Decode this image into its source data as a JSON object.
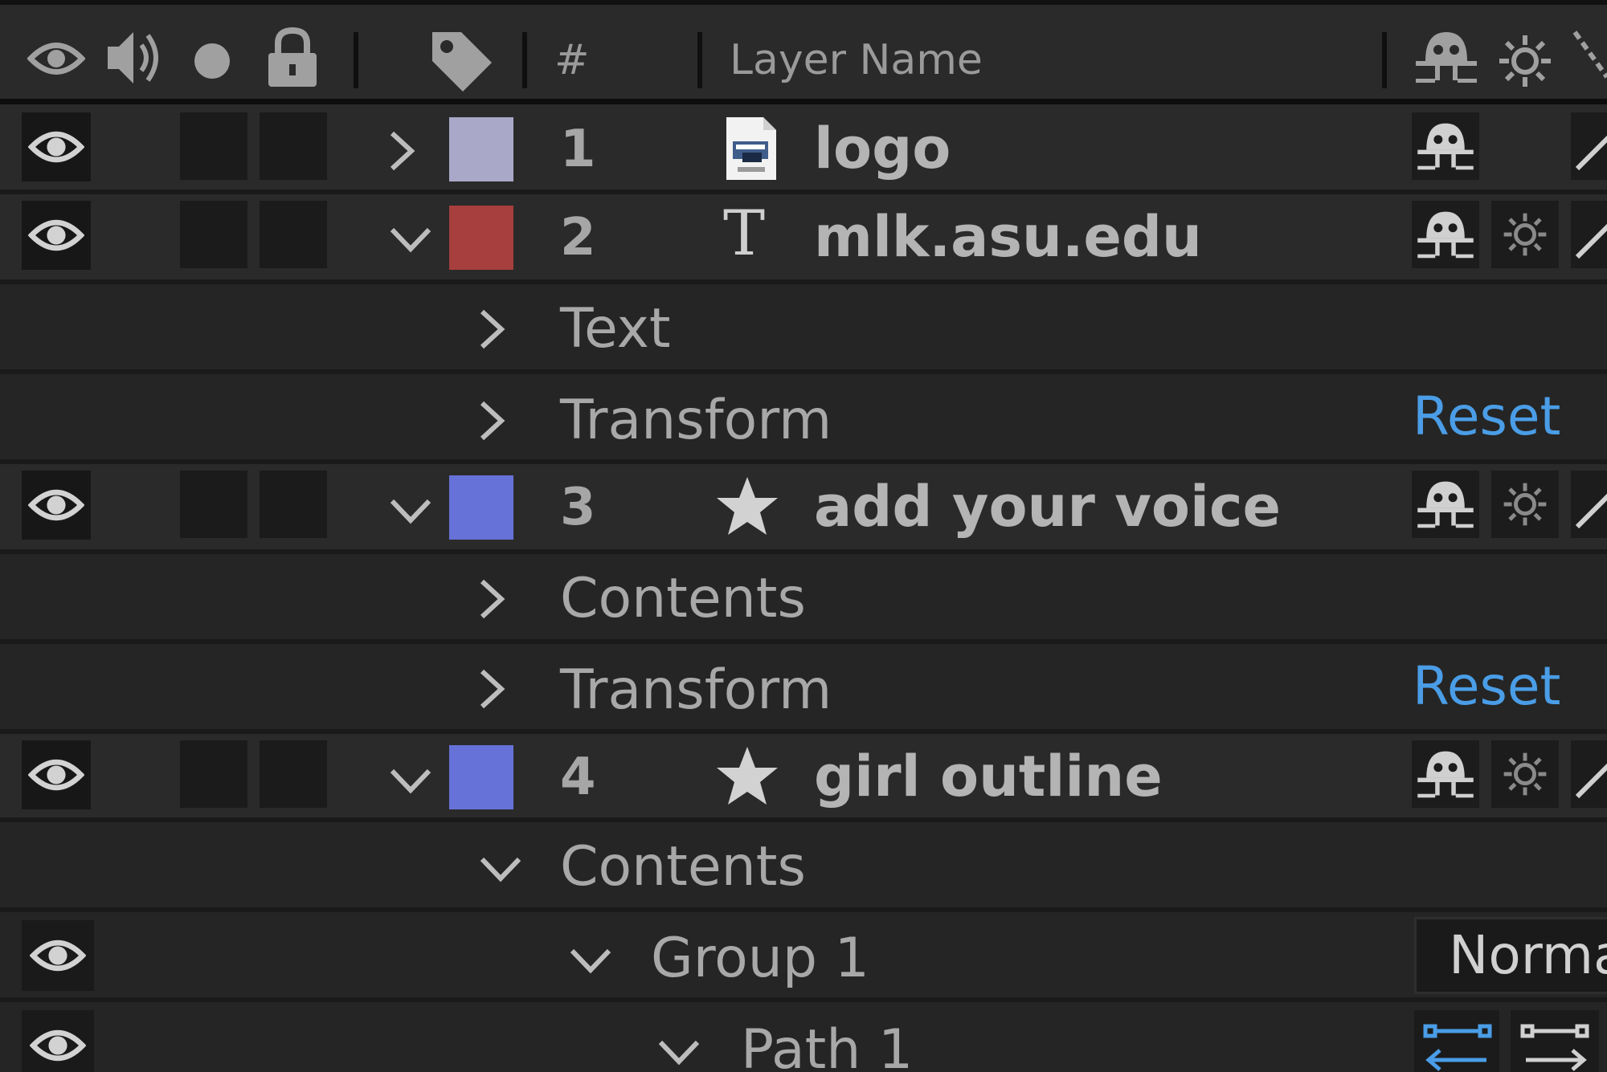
{
  "header": {
    "number_label": "#",
    "layer_name_label": "Layer Name"
  },
  "layers": [
    {
      "number": "1",
      "name": "logo",
      "label_color": "#a9a8c9",
      "type_icon": "psd-file-icon",
      "expanded": false
    },
    {
      "number": "2",
      "name": "mlk.asu.edu",
      "label_color": "#a63f3d",
      "type_icon": "text-layer-icon",
      "expanded": true
    },
    {
      "number": "3",
      "name": "add your voice",
      "label_color": "#6672d8",
      "type_icon": "shape-star-icon",
      "expanded": true
    },
    {
      "number": "4",
      "name": "girl outline",
      "label_color": "#6672d8",
      "type_icon": "shape-star-icon",
      "expanded": true
    }
  ],
  "properties": {
    "layer2_text": "Text",
    "layer2_transform": "Transform",
    "layer3_contents": "Contents",
    "layer3_transform": "Transform",
    "layer4_contents": "Contents",
    "group1": "Group 1",
    "path1": "Path 1"
  },
  "reset_label": "Reset",
  "blend_mode": "Normal",
  "text_layer_glyph": "T",
  "colors": {
    "accent_blue": "#4a9de6",
    "background": "#232323"
  }
}
